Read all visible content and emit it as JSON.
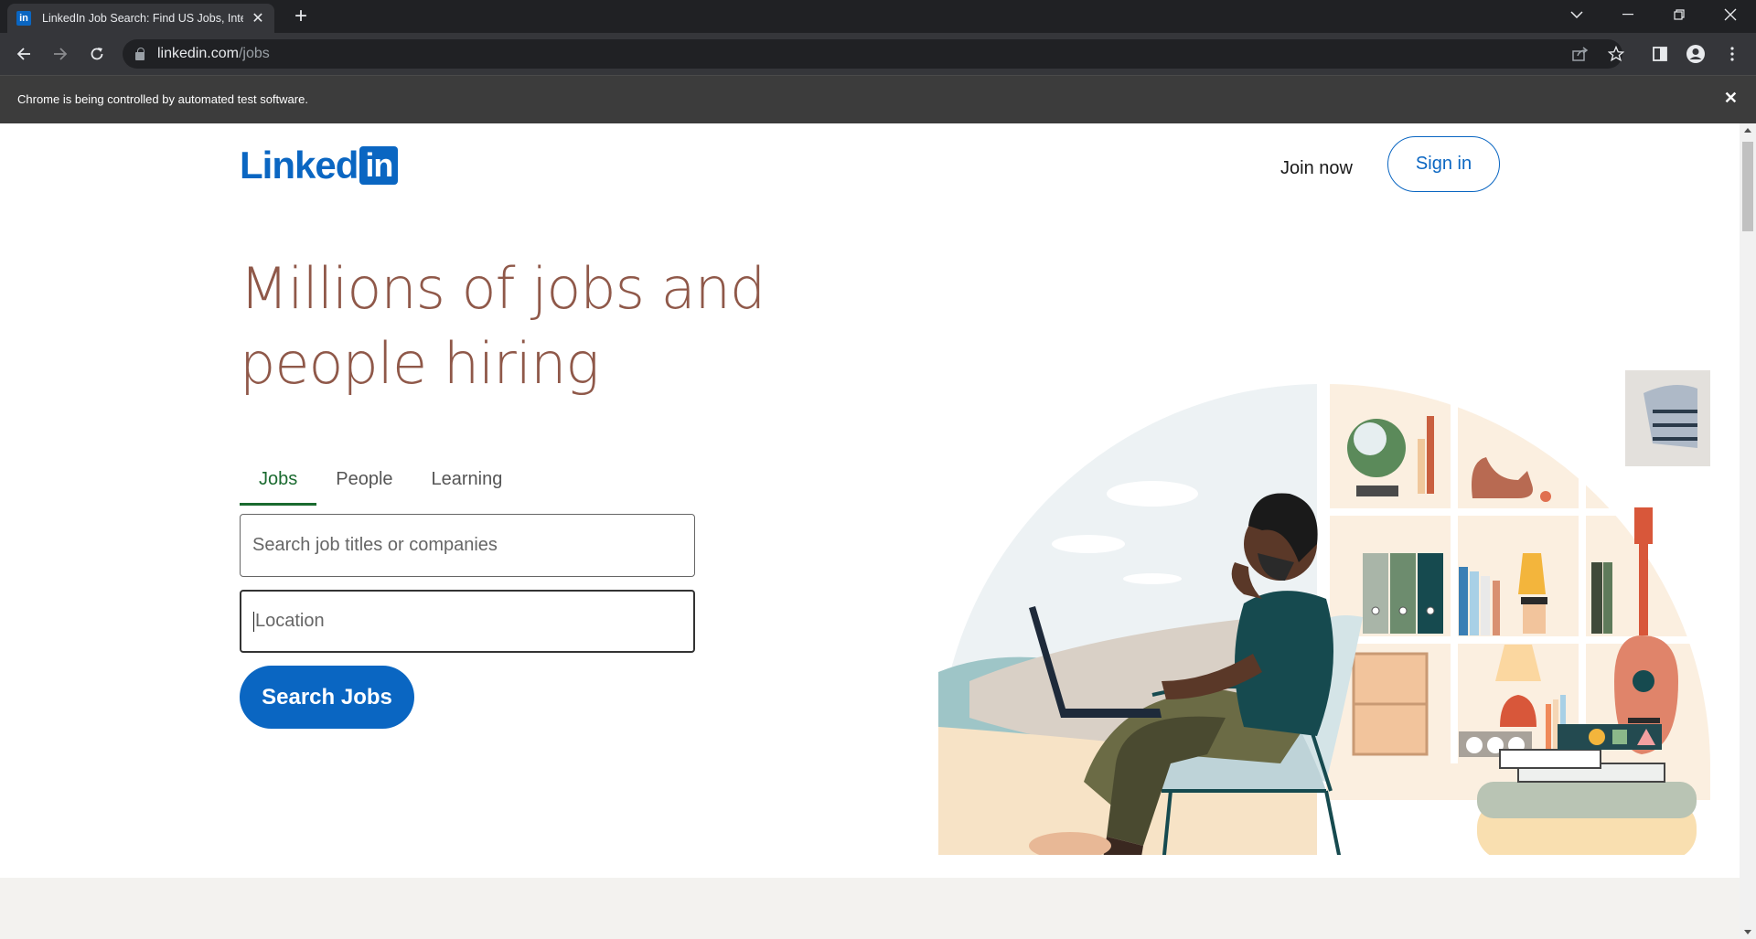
{
  "browser": {
    "tab_title": "LinkedIn Job Search: Find US Jobs, Inter",
    "tab_favicon": "in",
    "url_host": "linkedin.com",
    "url_path": "/jobs",
    "infobar_text": "Chrome is being controlled by automated test software.",
    "icons": {
      "back": "back-arrow-icon",
      "forward": "forward-arrow-icon",
      "reload": "reload-icon",
      "share": "share-icon",
      "bookmark": "star-icon",
      "sidepanel": "side-panel-icon",
      "profile": "profile-icon",
      "menu": "kebab-menu-icon"
    }
  },
  "header": {
    "logo_word": "Linked",
    "logo_in": "in",
    "join_label": "Join now",
    "signin_label": "Sign in"
  },
  "hero": {
    "headline_line1": "Millions of jobs and",
    "headline_line2": "people hiring"
  },
  "search": {
    "tabs": [
      {
        "label": "Jobs"
      },
      {
        "label": "People"
      },
      {
        "label": "Learning"
      }
    ],
    "active_tab": "Jobs",
    "keyword_placeholder": "Search job titles or companies",
    "location_placeholder": "Location",
    "submit_label": "Search Jobs"
  },
  "colors": {
    "brand_blue": "#0a66c2",
    "headline": "#8f5849",
    "active_tab": "#1a6a2f"
  }
}
